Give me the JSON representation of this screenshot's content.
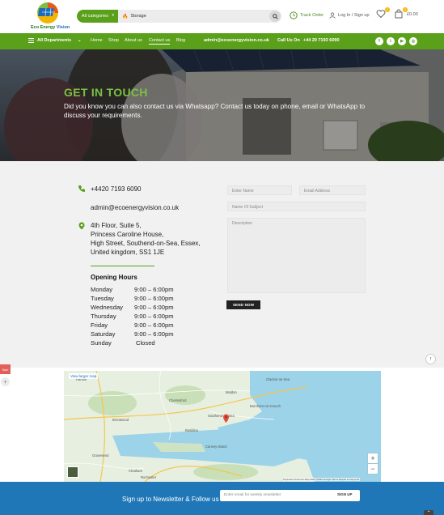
{
  "brand": {
    "name_part1": "Eco Energy",
    "name_part2": "Vision"
  },
  "search": {
    "category_label": "All categories",
    "value": "Storage"
  },
  "header_links": {
    "track_order": "Track Order",
    "login": "Log In / Sign up",
    "wishlist_count": "0",
    "cart_count": "0",
    "cart_total": "£0.00"
  },
  "nav": {
    "departments": "All Departments",
    "items": [
      "Home",
      "Shop",
      "About us",
      "Contact us",
      "Blog"
    ],
    "email": "admin@ecoenergyvision.co.uk",
    "call_label": "Call Us On",
    "phone": "+44 20 7193 6090",
    "social_icons": [
      "facebook-icon",
      "twitter-icon",
      "youtube-icon",
      "instagram-icon"
    ]
  },
  "hero": {
    "title": "GET IN TOUCH",
    "text": "Did you know you can also contact us via Whatsapp? Contact us today on phone, email or WhatsApp to discuss your requirements."
  },
  "contact": {
    "phone": "+4420 7193 6090",
    "email": "admin@ecoenergyvision.co.uk",
    "address": [
      "4th Floor, Suite 5,",
      "Princess Caroline House,",
      "High Street, Southend-on-Sea, Essex,",
      "United kingdom, SS1 1JE"
    ],
    "hours_title": "Opening Hours",
    "hours": [
      {
        "day": "Monday",
        "time": "9:00 – 6:00pm"
      },
      {
        "day": "Tuesday",
        "time": "9:00 – 6:00pm"
      },
      {
        "day": "Wednesday",
        "time": "9:00 – 6:00pm"
      },
      {
        "day": "Thursday",
        "time": "9:00 – 6:00pm"
      },
      {
        "day": "Friday",
        "time": "9:00 – 6:00pm"
      },
      {
        "day": "Saturday",
        "time": "9:00 – 6:00pm"
      },
      {
        "day": "Sunday",
        "time": "Closed"
      }
    ]
  },
  "form": {
    "name_placeholder": "Enter Name",
    "email_placeholder": "Email Address",
    "subject_placeholder": "Name Of Subject",
    "description_placeholder": "Description",
    "send_label": "SEND NOW"
  },
  "map": {
    "view_larger": "View larger map",
    "footer": "Keyboard shortcuts    Map data ©2024 Google    Terms    Report a map error",
    "labels": [
      "Clacton-on-Sea",
      "Southend-on-Sea",
      "Chelmsford",
      "Basildon",
      "Maldon",
      "Brentwood",
      "Gravesend",
      "Chatham",
      "Rochester",
      "Harlow",
      "Canvey Island",
      "Burnham-on-Crouch"
    ]
  },
  "newsletter": {
    "title": "Sign up to Newsletter & Follow us",
    "placeholder": "Enter email for weekly newsletter",
    "button": "SIGN UP"
  },
  "floating": {
    "left_tab": "Sale"
  }
}
